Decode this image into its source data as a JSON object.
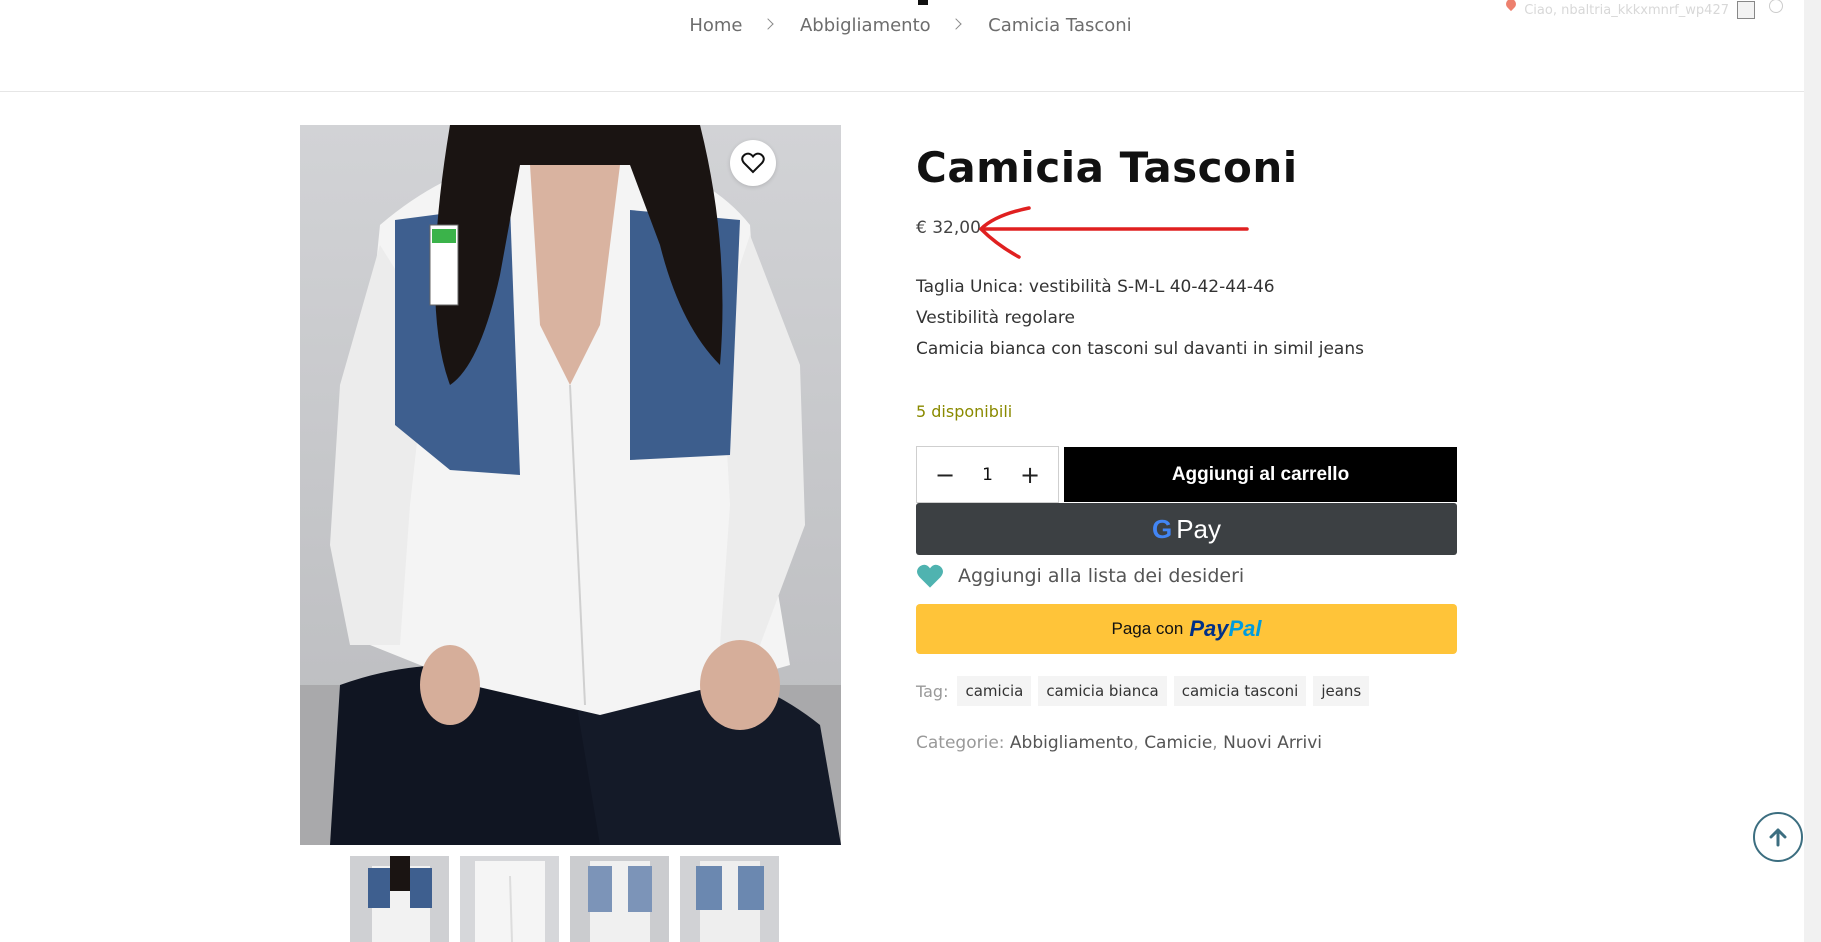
{
  "header": {
    "breadcrumb": [
      "Home",
      "Abbigliamento",
      "Camicia Tasconi"
    ],
    "user_greeting": "Ciao, nbaltria_kkkxmnrf_wp427"
  },
  "product": {
    "title": "Camicia Tasconi",
    "price": "€ 32,00",
    "description": [
      "Taglia Unica: vestibilità S-M-L  40-42-44-46",
      "Vestibilità regolare",
      "Camicia bianca con tasconi sul davanti in simil jeans"
    ],
    "stock": "5 disponibili",
    "quantity": "1",
    "add_to_cart": "Aggiungi al carrello",
    "gpay_label": "Pay",
    "wishlist_label": "Aggiungi alla lista dei desideri",
    "paypal_prefix": "Paga con",
    "paypal_logo_a": "Pay",
    "paypal_logo_b": "Pal",
    "tags_label": "Tag:",
    "tags": [
      "camicia",
      "camicia bianca",
      "camicia tasconi",
      "jeans"
    ],
    "categories_label": "Categorie:",
    "categories": [
      "Abbigliamento",
      "Camicie",
      "Nuovi Arrivi"
    ]
  },
  "icons": {
    "wishlist_top": "heart-outline-icon",
    "wishlist_inline": "heart-filled-icon",
    "back_to_top": "arrow-up-icon",
    "annotation": "red-arrow-annotation"
  },
  "colors": {
    "accent_teal": "#4fb3b0",
    "add_to_cart_bg": "#000000",
    "gpay_bg": "#3c4043",
    "paypal_bg": "#ffc439",
    "stock_text": "#8a8a00",
    "annotation_red": "#e02020"
  }
}
